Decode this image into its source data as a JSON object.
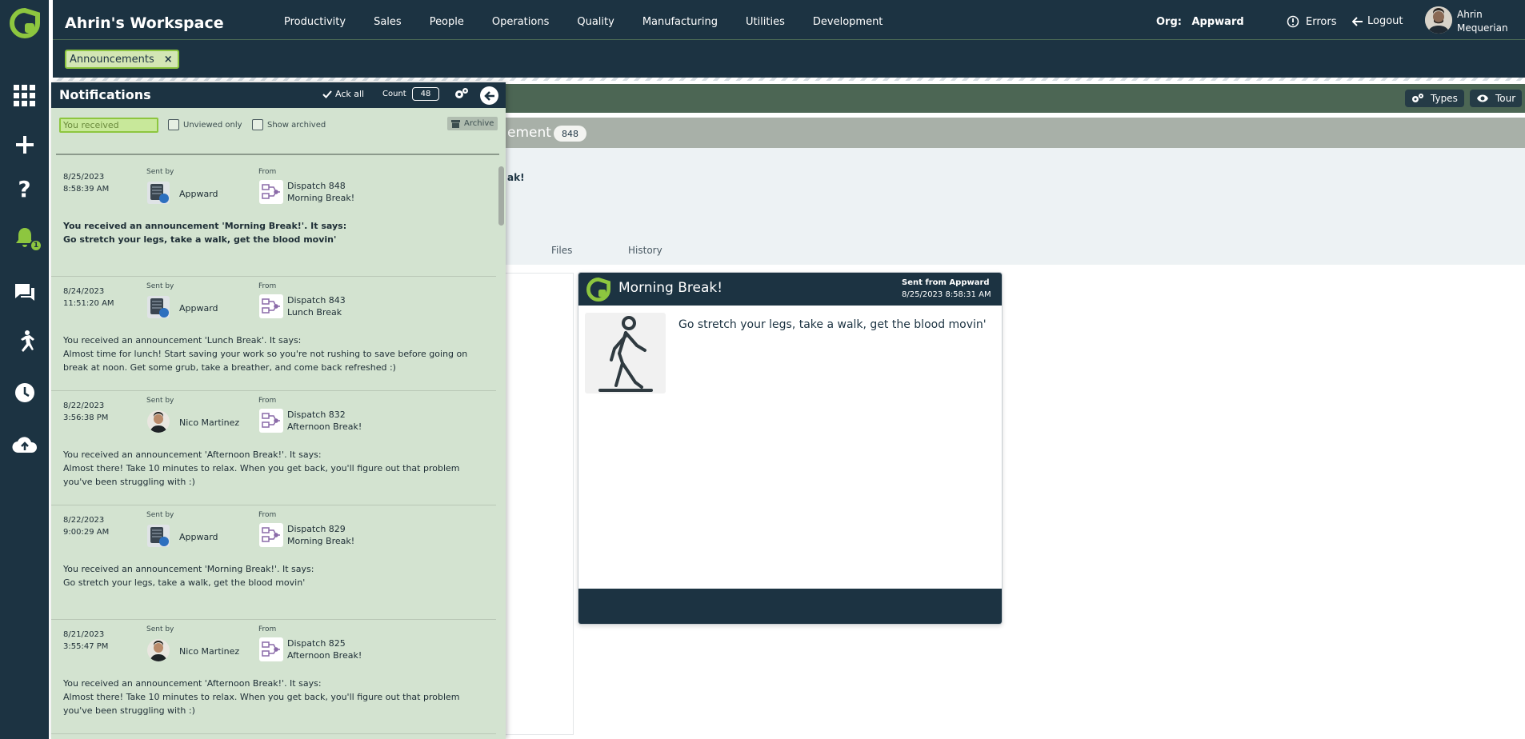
{
  "header": {
    "workspace_title": "Ahrin's Workspace",
    "menu": [
      "Productivity",
      "Sales",
      "People",
      "Operations",
      "Quality",
      "Manufacturing",
      "Utilities",
      "Development"
    ],
    "org_label": "Org:",
    "org_name": "Appward",
    "errors_label": "Errors",
    "logout_label": "Logout",
    "user_first": "Ahrin",
    "user_last": "Mequerian",
    "open_tab": "Announcements",
    "open_tab_close": "×"
  },
  "rail": {
    "icons": [
      "apps-grid-icon",
      "plus-icon",
      "help-icon",
      "bell-icon",
      "chat-icon",
      "runner-icon",
      "clock-icon",
      "cloud-upload-icon"
    ],
    "notification_badge": "1"
  },
  "background_page": {
    "types_label": "Types",
    "tour_label": "Tour",
    "title_fragment": "ement",
    "count": "848",
    "info_fragment": "ak!",
    "tabs": [
      "Files",
      "History"
    ]
  },
  "preview_card": {
    "title": "Morning Break!",
    "sent_from": "Sent from Appward",
    "sent_at": "8/25/2023 8:58:31 AM",
    "message": "Go stretch your legs, take a walk, get the blood movin'"
  },
  "notifications": {
    "title": "Notifications",
    "ack_all_label": "Ack all",
    "count_label": "Count",
    "count_value": "48",
    "filter_value": "You received",
    "unviewed_label": "Unviewed only",
    "show_archived_label": "Show archived",
    "archive_label": "Archive",
    "sent_by_label": "Sent by",
    "from_label": "From",
    "items": [
      {
        "date": "8/25/2023",
        "time": "8:58:39 AM",
        "sender": "Appward",
        "sender_avatar": "server-icon",
        "dispatch": "Dispatch 848",
        "source": "Morning Break!",
        "line1": "You received an announcement 'Morning Break!'. It says:",
        "line2": "Go stretch your legs, take a walk, get the blood movin'",
        "unread": true
      },
      {
        "date": "8/24/2023",
        "time": "11:51:20 AM",
        "sender": "Appward",
        "sender_avatar": "server-icon",
        "dispatch": "Dispatch 843",
        "source": "Lunch Break",
        "line1": "You received an announcement 'Lunch Break'. It says:",
        "line2": "Almost time for lunch! Start saving your work so you're not rushing to save before going on break at noon. Get some grub, take a breather, and come back refreshed :)",
        "unread": false
      },
      {
        "date": "8/22/2023",
        "time": "3:56:38 PM",
        "sender": "Nico Martinez",
        "sender_avatar": "person-avatar",
        "dispatch": "Dispatch 832",
        "source": "Afternoon Break!",
        "line1": "You received an announcement 'Afternoon Break!'. It says:",
        "line2": "Almost there! Take 10 minutes to relax. When you get back, you'll figure out that problem you've been struggling with :)",
        "unread": false
      },
      {
        "date": "8/22/2023",
        "time": "9:00:29 AM",
        "sender": "Appward",
        "sender_avatar": "server-icon",
        "dispatch": "Dispatch 829",
        "source": "Morning Break!",
        "line1": "You received an announcement 'Morning Break!'. It says:",
        "line2": "Go stretch your legs, take a walk, get the blood movin'",
        "unread": false
      },
      {
        "date": "8/21/2023",
        "time": "3:55:47 PM",
        "sender": "Nico Martinez",
        "sender_avatar": "person-avatar",
        "dispatch": "Dispatch 825",
        "source": "Afternoon Break!",
        "line1": "You received an announcement 'Afternoon Break!'. It says:",
        "line2": "Almost there! Take 10 minutes to relax. When you get back, you'll figure out that problem you've been struggling with :)",
        "unread": false
      }
    ]
  },
  "colors": {
    "navy": "#1c3342",
    "accent_green": "#8dc63f",
    "panel_green": "#d3e3d0",
    "header_green": "#4c6654"
  }
}
